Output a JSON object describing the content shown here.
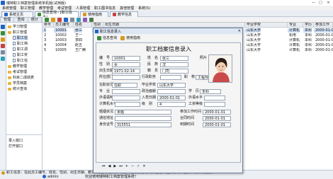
{
  "window": {
    "title": "瑞特职工档案管理系统单机版(试用版)",
    "min": "—",
    "max": "□",
    "close": "✕"
  },
  "menu": [
    "系统管理",
    "职工管理",
    "教学管理",
    "考试管理",
    "人事管理",
    "职工图书信息",
    "其他管理",
    "系统(S)"
  ],
  "tabs": [
    {
      "label": "系统主页"
    },
    {
      "label": "信息查询 - [职工信息]"
    },
    {
      "label": "使用指南"
    },
    {
      "label": "教学信息"
    }
  ],
  "left_tabs": [
    "管理",
    "查询",
    "统计"
  ],
  "tree": [
    {
      "label": "学习管理",
      "level": 0
    },
    {
      "label": "职工管理",
      "level": 0
    },
    {
      "label": "职工信",
      "level": 1
    },
    {
      "label": "职工档",
      "level": 1
    },
    {
      "label": "职工调",
      "level": 1
    },
    {
      "label": "职工奖",
      "level": 1
    },
    {
      "label": "职工信",
      "level": 1
    },
    {
      "label": "教学管理",
      "level": 0
    },
    {
      "label": "考试管理",
      "level": 0
    },
    {
      "label": "科目二成绩表",
      "level": 0
    },
    {
      "label": "学员档案",
      "level": 0
    },
    {
      "label": "统计查询",
      "level": 0
    }
  ],
  "small_panel": [
    "录入窗口",
    "打开窗口"
  ],
  "grid": {
    "columns": [
      "序号",
      "员工编号",
      "姓名",
      "性别",
      "出生日期",
      "毕业学校",
      "专业",
      "学历",
      "参加工作"
    ],
    "rows": [
      [
        "1",
        "10001",
        "张三",
        "女",
        "",
        "山东大学",
        "计算机",
        "本科",
        "2000-01-01"
      ],
      [
        "2",
        "10002",
        "王一",
        "女",
        "",
        "山东大学",
        "机电",
        "本科",
        "2000-01-01"
      ],
      [
        "3",
        "10003",
        "李四",
        "男",
        "",
        "山东大学",
        "计算机",
        "本科",
        "2000-01-01"
      ],
      [
        "4",
        "10004",
        "赵五",
        "女",
        "",
        "山东大学",
        "计算机",
        "本科",
        "2000-01-01"
      ],
      [
        "5",
        "10005",
        "王广腾",
        "男",
        "",
        "山东大学",
        "计算机",
        "本科",
        "2000-01-01"
      ]
    ]
  },
  "dialog": {
    "title": "职工信息录入",
    "tool_query": "信息查询",
    "tool_guide": "使用指南",
    "card_title": "职工档案信息录入",
    "fields": {
      "id_label": "编　号",
      "id_value": "10001",
      "name_label": "姓　名",
      "name_value": "张三",
      "sex_label": "性　别",
      "sex_value": "女",
      "nation_label": "民　族",
      "nation_value": "汉",
      "birth_label": "出生日期",
      "birth_value": "1971-02-14",
      "origin_label": "籍　贯",
      "origin_value": "门司",
      "dept_label": "所在部门",
      "dept_value": "",
      "duty_label": "行政职务",
      "duty_value": "",
      "title_label": "职　称",
      "title_value": "工程师",
      "worktype_label": "在职状况",
      "worktype_value": "在职",
      "school_label": "毕业学校",
      "school_value": "山东大学",
      "major_label": "专　业",
      "major_value": "",
      "degree_label": "学　历",
      "degree_value": "本科",
      "politics_label": "政治面貌",
      "politics_value": "",
      "party_date_label": "入党日期",
      "party_date_value": "2000-01-01",
      "foreign_label": "外语语种",
      "foreign_value": "",
      "foreign_level_label": "外语水平",
      "foreign_level_value": "",
      "computer_label": "计算机水平",
      "computer_value": "",
      "level_label": "级　别",
      "level_value": "4",
      "tech_label": "工资等级",
      "tech_value": "",
      "marital_label": "婚姻状况",
      "marital_value": "未婚",
      "hire_label": "参加工作时间",
      "hire_value": "2000-01-01",
      "address_label": "通信地址",
      "address_value": "",
      "contract_label": "合同时间",
      "contract_value": "2000-01-01",
      "idcard_label": "身份证号",
      "idcard_value": "315551",
      "expire_label": "到期时间",
      "expire_value": "2000-01-01",
      "photo_label": "照片"
    },
    "nav_symbols": [
      "⏮",
      "◀",
      "▶",
      "⏭",
      "+",
      "−",
      "✓",
      "✕"
    ]
  },
  "status": {
    "hint": "职工信息：在此员工编号、姓名、性别、出生日期、籍贯、民族、部门、职务、在职状态等相关信息，提供修改、删除、照片等服务。",
    "user": "admin",
    "welcome": "欢迎使用瑞特职工档案管理系统！"
  },
  "colors": {
    "accent": "#1e63c8",
    "folder": "#e9b53c",
    "highlight": "#cfe0f7"
  }
}
